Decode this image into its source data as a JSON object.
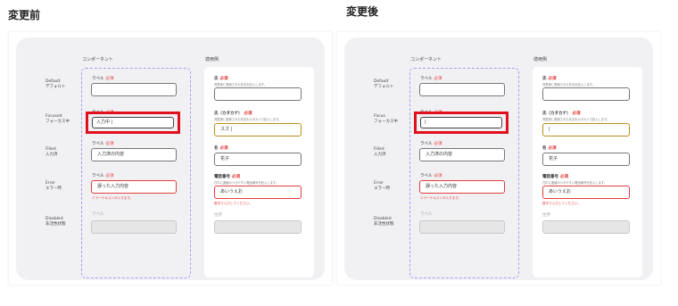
{
  "headings": {
    "before": "変更前",
    "after": "変更後"
  },
  "panels": [
    {
      "component_title": "コンポーネント",
      "example_title": "適用例",
      "states": [
        {
          "en": "Default",
          "ja": "デフォルト"
        },
        {
          "en": "Focused",
          "ja": "フォーカス中"
        },
        {
          "en": "Filled",
          "ja": "入力済"
        },
        {
          "en": "Error",
          "ja": "エラー時"
        },
        {
          "en": "Disabled",
          "ja": "非活性状態"
        }
      ],
      "component": {
        "label": "ラベル",
        "required": "必須",
        "focused_value": "入力中 |",
        "filled_value": "入力済の内容",
        "error_value": "誤った入力内容",
        "error_message": "エラーテキストが入ります。"
      },
      "example": {
        "field1_label": "氏",
        "field1_help": "児童家に登録された氏名を記入します。",
        "field2_label": "氏（カタカナ）",
        "field2_help": "児童家に登録された氏名をカタカナで記入します。",
        "field2_value": "スズ |",
        "field3_label": "名",
        "field3_value": "花子",
        "field4_label": "電話番号",
        "field4_help": "日中に連絡のつきやすい電話番号を記入します。",
        "field4_value": "あいうえお",
        "field4_error": "数字で入力してください。",
        "field5_label": "住所",
        "required": "必須"
      }
    },
    {
      "component_title": "コンポーネント",
      "example_title": "適用例",
      "states": [
        {
          "en": "Default",
          "ja": "デフォルト"
        },
        {
          "en": "Focus",
          "ja": "フォーカス中"
        },
        {
          "en": "Filled",
          "ja": "入力済"
        },
        {
          "en": "Error",
          "ja": "エラー時"
        },
        {
          "en": "Disabled",
          "ja": "非活性状態"
        }
      ],
      "component": {
        "label": "ラベル",
        "required": "必須",
        "focused_value": "|",
        "filled_value": "入力済の内容",
        "error_value": "誤った入力内容",
        "error_message": "エラーテキストが入ります。"
      },
      "example": {
        "field1_label": "氏",
        "field1_help": "児童家に登録された氏名を記入します。",
        "field2_label": "氏（カタカナ）",
        "field2_help": "児童家に登録された氏名をカタカナで記入します。",
        "field2_value": "|",
        "field3_label": "名",
        "field3_value": "花子",
        "field4_label": "電話番号",
        "field4_help": "日中に連絡のつきやすい電話番号を記入します。",
        "field4_value": "あいうえお",
        "field4_error": "数字で入力してください。",
        "field5_label": "住所",
        "required": "必須"
      }
    }
  ]
}
